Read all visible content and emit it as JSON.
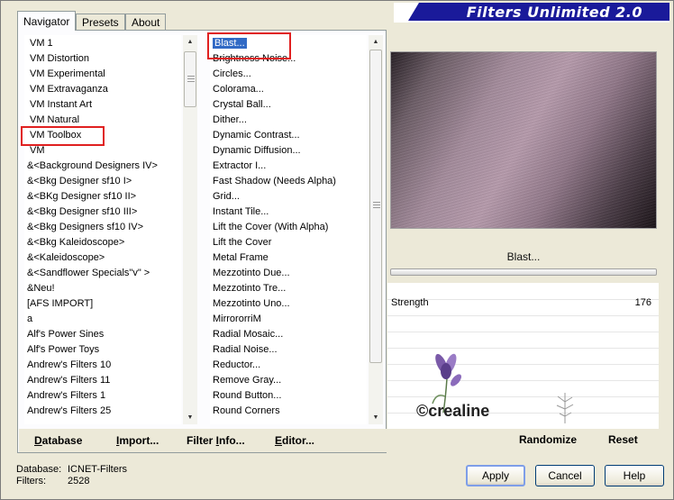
{
  "brand": {
    "title": "Filters Unlimited 2.0"
  },
  "tabs": [
    {
      "label": "Navigator"
    },
    {
      "label": "Presets"
    },
    {
      "label": "About"
    }
  ],
  "categories": [
    "VM 1",
    "VM Distortion",
    "VM Experimental",
    "VM Extravaganza",
    "VM Instant Art",
    "VM Natural",
    "VM Toolbox",
    "VM",
    "&<Background Designers IV>",
    "&<Bkg Designer sf10 I>",
    "&<BKg Designer sf10 II>",
    "&<Bkg Designer sf10 III>",
    "&<Bkg Designers sf10 IV>",
    "&<Bkg Kaleidoscope>",
    "&<Kaleidoscope>",
    "&<Sandflower Specials\"v\" >",
    "&Neu!",
    "[AFS IMPORT]",
    "a",
    "Alf's Power Sines",
    "Alf's Power Toys",
    "Andrew's Filters 10",
    "Andrew's Filters 11",
    "Andrew's Filters 1",
    "Andrew's Filters 25"
  ],
  "filters": [
    "Blast...",
    "Brightness Noise...",
    "Circles...",
    "Colorama...",
    "Crystal Ball...",
    "Dither...",
    "Dynamic Contrast...",
    "Dynamic Diffusion...",
    "Extractor I...",
    "Fast Shadow (Needs Alpha)",
    "Grid...",
    "Instant Tile...",
    "Lift the Cover (With Alpha)",
    "Lift the Cover",
    "Metal Frame",
    "Mezzotinto Due...",
    "Mezzotinto Tre...",
    "Mezzotinto Uno...",
    "MirrororriM",
    "Radial Mosaic...",
    "Radial Noise...",
    "Reductor...",
    "Remove Gray...",
    "Round Button...",
    "Round Corners"
  ],
  "selected_category": "VM Toolbox",
  "selected_filter": "Blast...",
  "left_buttons": [
    {
      "first": "D",
      "rest": "atabase"
    },
    {
      "first": "I",
      "rest": "mport..."
    },
    {
      "first": "Filter ",
      "mid": "I",
      "rest": "nfo..."
    },
    {
      "first": "E",
      "rest": "ditor..."
    }
  ],
  "preview": {
    "filter_name": "Blast..."
  },
  "parameter": {
    "label": "Strength",
    "value": "176"
  },
  "watermark": "©crealine",
  "right_buttons": {
    "randomize": "Randomize",
    "reset": "Reset"
  },
  "status": {
    "database_label": "Database:",
    "database_value": "ICNET-Filters",
    "filters_label": "Filters:",
    "filters_value": "2528"
  },
  "dialog_buttons": {
    "apply": "Apply",
    "cancel": "Cancel",
    "help": "Help"
  },
  "colors": {
    "brand_blue": "#1a1a9a",
    "selection": "#316ac5",
    "highlight_box": "#e02020"
  }
}
